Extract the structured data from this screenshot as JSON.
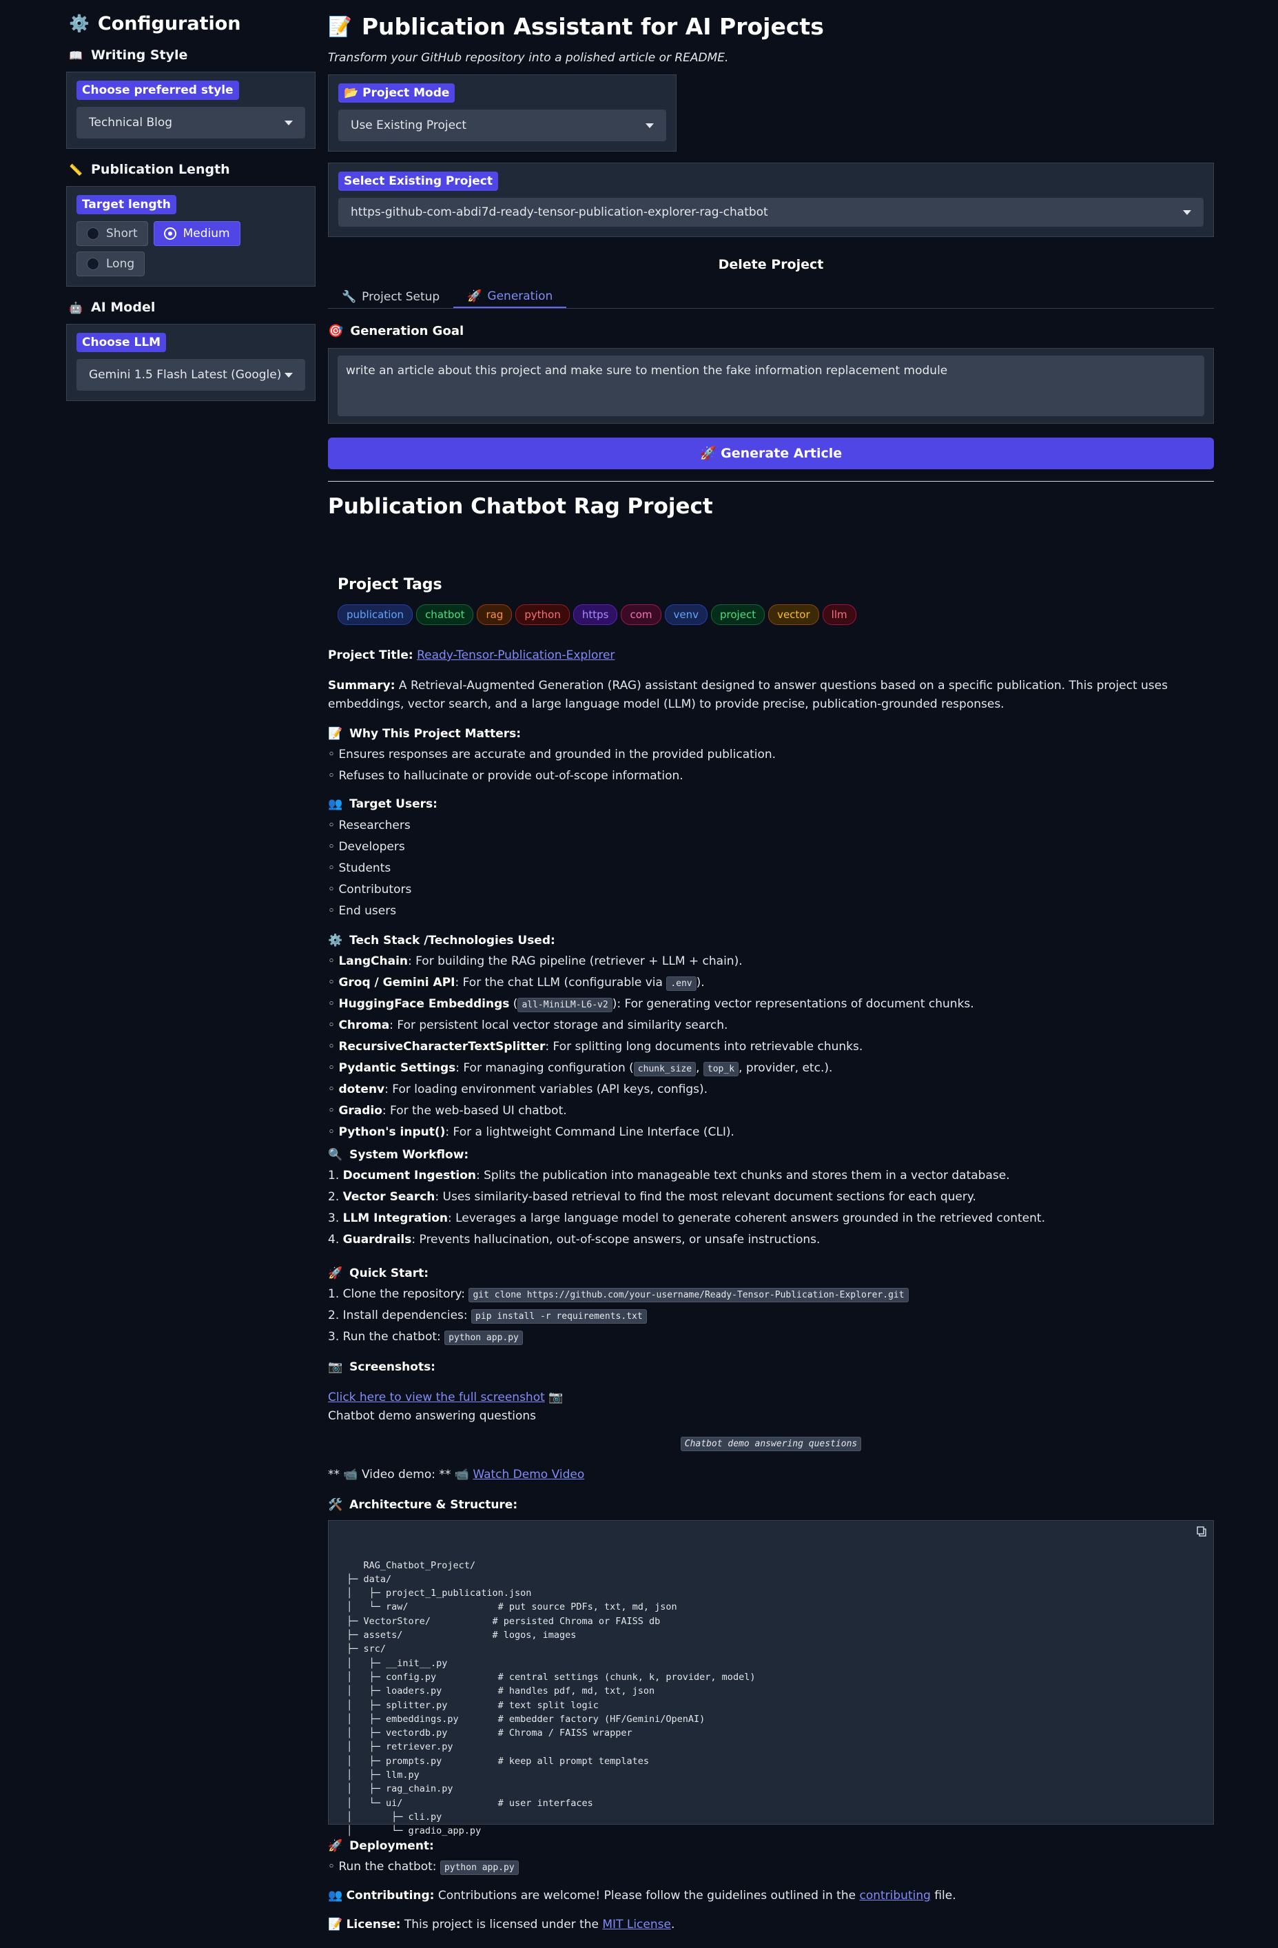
{
  "sidebar": {
    "title": "Configuration",
    "writing_style": {
      "heading": "Writing Style",
      "label": "Choose preferred style",
      "value": "Technical Blog"
    },
    "publication_length": {
      "heading": "Publication Length",
      "label": "Target length",
      "options": [
        "Short",
        "Medium",
        "Long"
      ],
      "selected": "Medium"
    },
    "ai_model": {
      "heading": "AI Model",
      "label": "Choose LLM",
      "value": "Gemini 1.5 Flash Latest (Google)"
    }
  },
  "header": {
    "title": "Publication Assistant for AI Projects",
    "subtitle": "Transform your GitHub repository into a polished article or README."
  },
  "project_mode": {
    "label": "Project Mode",
    "value": "Use Existing Project"
  },
  "select_project": {
    "label": "Select Existing Project",
    "value": "https-github-com-abdi7d-ready-tensor-publication-explorer-rag-chatbot"
  },
  "delete_label": "Delete Project",
  "tabs": [
    {
      "label": "Project Setup",
      "icon": "wrench-icon"
    },
    {
      "label": "Generation",
      "icon": "rocket-icon",
      "active": true
    }
  ],
  "generation": {
    "goal_heading": "Generation Goal",
    "goal_value": "write an article about this project and make sure to mention the fake information replacement module",
    "button_label": "Generate Article"
  },
  "article": {
    "title": "Publication Chatbot Rag Project",
    "tags_heading": "Project Tags",
    "tags": [
      "publication",
      "chatbot",
      "rag",
      "python",
      "https",
      "com",
      "venv",
      "project",
      "vector",
      "llm"
    ],
    "project_title_label": "Project Title:",
    "project_title_link": "Ready-Tensor-Publication-Explorer",
    "summary_label": "Summary:",
    "summary_text": "A Retrieval-Augmented Generation (RAG) assistant designed to answer questions based on a specific publication. This project uses embeddings, vector search, and a large language model (LLM) to provide precise, publication-grounded responses.",
    "why_heading": "Why This Project Matters:",
    "why_items": [
      "Ensures responses are accurate and grounded in the provided publication.",
      "Refuses to hallucinate or provide out-of-scope information."
    ],
    "users_heading": "Target Users:",
    "users_items": [
      "Researchers",
      "Developers",
      "Students",
      "Contributors",
      "End users"
    ],
    "tech_heading": "Tech Stack /Technologies Used:",
    "tech_items": [
      {
        "b": "LangChain",
        "pre": "",
        "code": "",
        "rest": ": For building the RAG pipeline (retriever + LLM + chain)."
      },
      {
        "b": "Groq / Gemini API",
        "pre": ": For the chat LLM (configurable via ",
        "code": ".env",
        "rest": ")."
      },
      {
        "b": "HuggingFace Embeddings",
        "pre": " (",
        "code": "all-MiniLM-L6-v2",
        "rest": "): For generating vector representations of document chunks."
      },
      {
        "b": "Chroma",
        "pre": "",
        "code": "",
        "rest": ": For persistent local vector storage and similarity search."
      },
      {
        "b": "RecursiveCharacterTextSplitter",
        "pre": "",
        "code": "",
        "rest": ": For splitting long documents into retrievable chunks."
      },
      {
        "b": "Pydantic Settings",
        "pre": ": For managing configuration (",
        "code": "chunk_size",
        "code2": "top_k",
        "rest": ", provider, etc.)."
      },
      {
        "b": "dotenv",
        "pre": "",
        "code": "",
        "rest": ": For loading environment variables (API keys, configs)."
      },
      {
        "b": "Gradio",
        "pre": "",
        "code": "",
        "rest": ": For the web-based UI chatbot."
      },
      {
        "b": "Python's input()",
        "pre": "",
        "code": "",
        "rest": ": For a lightweight Command Line Interface (CLI)."
      }
    ],
    "workflow_heading": "System Workflow:",
    "workflow_items": [
      {
        "n": "1.",
        "b": "Document Ingestion",
        "rest": ": Splits the publication into manageable text chunks and stores them in a vector database."
      },
      {
        "n": "2.",
        "b": "Vector Search",
        "rest": ": Uses similarity-based retrieval to find the most relevant document sections for each query."
      },
      {
        "n": "3.",
        "b": "LLM Integration",
        "rest": ": Leverages a large language model to generate coherent answers grounded in the retrieved content."
      },
      {
        "n": "4.",
        "b": "Guardrails",
        "rest": ": Prevents hallucination, out-of-scope answers, or unsafe instructions."
      }
    ],
    "quick_heading": "Quick Start:",
    "quick_items": [
      {
        "n": "1.",
        "text": "Clone the repository:",
        "code": "git clone https://github.com/your-username/Ready-Tensor-Publication-Explorer.git"
      },
      {
        "n": "2.",
        "text": "Install dependencies:",
        "code": "pip install -r requirements.txt"
      },
      {
        "n": "3.",
        "text": "Run the chatbot:",
        "code": "python app.py"
      }
    ],
    "screenshots_heading": "Screenshots:",
    "screenshot_link": "Click here to view the full screenshot",
    "screenshot_caption": "Chatbot demo answering questions",
    "screenshot_alt": "Chatbot demo answering questions",
    "video_prefix": "** 📹 Video demo: **",
    "video_link": "Watch Demo Video",
    "arch_heading": "Architecture & Structure:",
    "arch_code": "RAG_Chatbot_Project/\n ├─ data/\n │   ├─ project_1_publication.json\n │   └─ raw/                # put source PDFs, txt, md, json\n ├─ VectorStore/           # persisted Chroma or FAISS db\n ├─ assets/                # logos, images\n ├─ src/\n │   ├─ __init__.py\n │   ├─ config.py           # central settings (chunk, k, provider, model)\n │   ├─ loaders.py          # handles pdf, md, txt, json\n │   ├─ splitter.py         # text split logic\n │   ├─ embeddings.py       # embedder factory (HF/Gemini/OpenAI)\n │   ├─ vectordb.py         # Chroma / FAISS wrapper\n │   ├─ retriever.py\n │   ├─ prompts.py          # keep all prompt templates\n │   ├─ llm.py\n │   ├─ rag_chain.py\n │   └─ ui/                 # user interfaces\n │       ├─ cli.py\n │       └─ gradio_app.py",
    "deploy_heading": "Deployment:",
    "deploy_item_text": "Run the chatbot:",
    "deploy_item_code": "python app.py",
    "contrib_label": "Contributing:",
    "contrib_text": "Contributions are welcome! Please follow the guidelines outlined in the",
    "contrib_link": "contributing",
    "contrib_suffix": "file.",
    "license_label": "License:",
    "license_text": "This project is licensed under the",
    "license_link": "MIT License",
    "license_suffix": "."
  }
}
